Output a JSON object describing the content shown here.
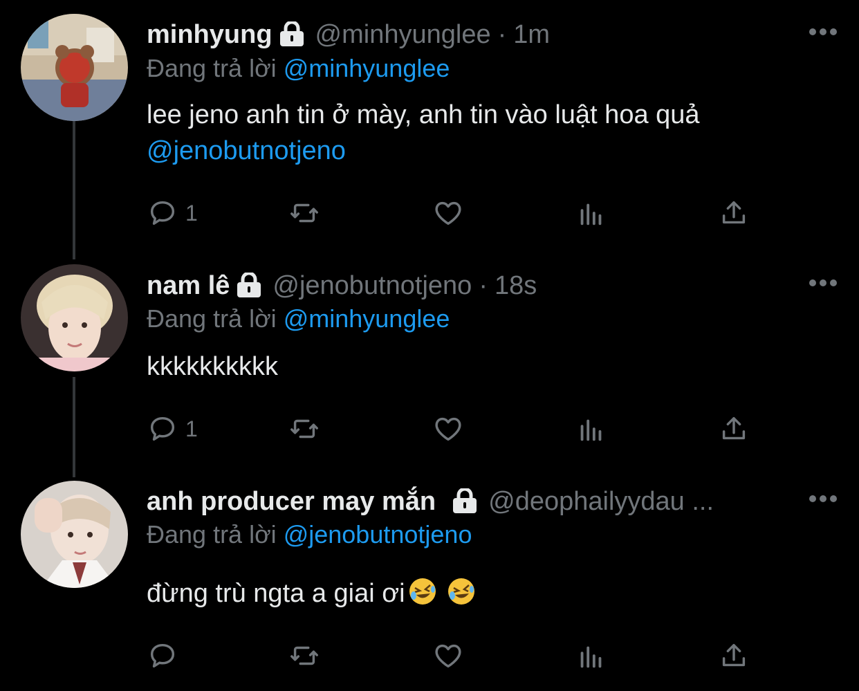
{
  "tweets": [
    {
      "name": "minhyung",
      "handle": "@minhyunglee",
      "time": "1m",
      "reply_prefix": "Đang trả lời",
      "reply_to": "@minhyunglee",
      "text": "lee jeno anh tin ở mày, anh tin vào luật hoa quả",
      "text_mention": "@jenobutnotjeno",
      "replies": "1"
    },
    {
      "name": "nam lê",
      "handle": "@jenobutnotjeno",
      "time": "18s",
      "reply_prefix": "Đang trả lời",
      "reply_to": "@minhyunglee",
      "text": "kkkkkkkkkk",
      "replies": "1"
    },
    {
      "name": "anh producer may mắn",
      "handle": "@deophailyydau ...",
      "reply_prefix": "Đang trả lời",
      "reply_to": "@jenobutnotjeno",
      "text": "đừng trù ngta a giai ơi",
      "emoji": [
        "rolling-on-floor-laughing-emoji",
        "rolling-on-floor-laughing-emoji"
      ]
    }
  ],
  "separator": "·",
  "colors": {
    "background": "#000000",
    "text": "#e7e9ea",
    "muted": "#71767b",
    "accent": "#1d9bf0",
    "thread_line": "#333639"
  },
  "icons": [
    "lock-icon",
    "more-icon",
    "reply-icon",
    "retweet-icon",
    "like-icon",
    "views-icon",
    "share-icon"
  ]
}
